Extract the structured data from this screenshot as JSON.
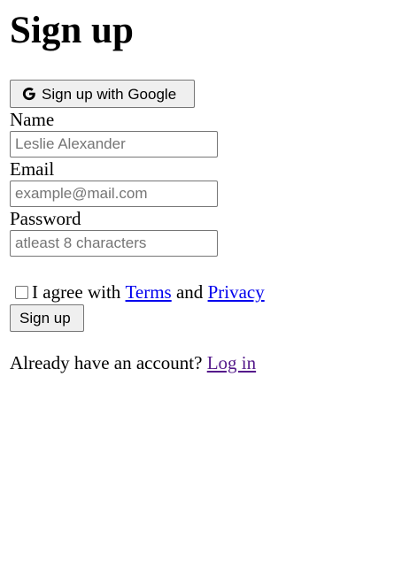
{
  "form": {
    "title": "Sign up",
    "google_button_label": "Sign up with Google",
    "name_label": "Name",
    "name_placeholder": "Leslie Alexander",
    "email_label": "Email",
    "email_placeholder": "example@mail.com",
    "password_label": "Password",
    "password_placeholder": "atleast 8 characters",
    "agree_prefix": "I agree with",
    "terms_link": "Terms",
    "agree_and": "and",
    "privacy_link": "Privacy",
    "submit_label": "Sign up",
    "login_prompt": "Already have an account?",
    "login_link": "Log in"
  },
  "icons": {
    "google": "google-icon",
    "checkbox": "checkbox-unchecked"
  },
  "colors": {
    "link": "#0000ee",
    "visited_link": "#551a8b",
    "button_bg": "#efefef",
    "border": "#767676",
    "placeholder": "#757575"
  }
}
